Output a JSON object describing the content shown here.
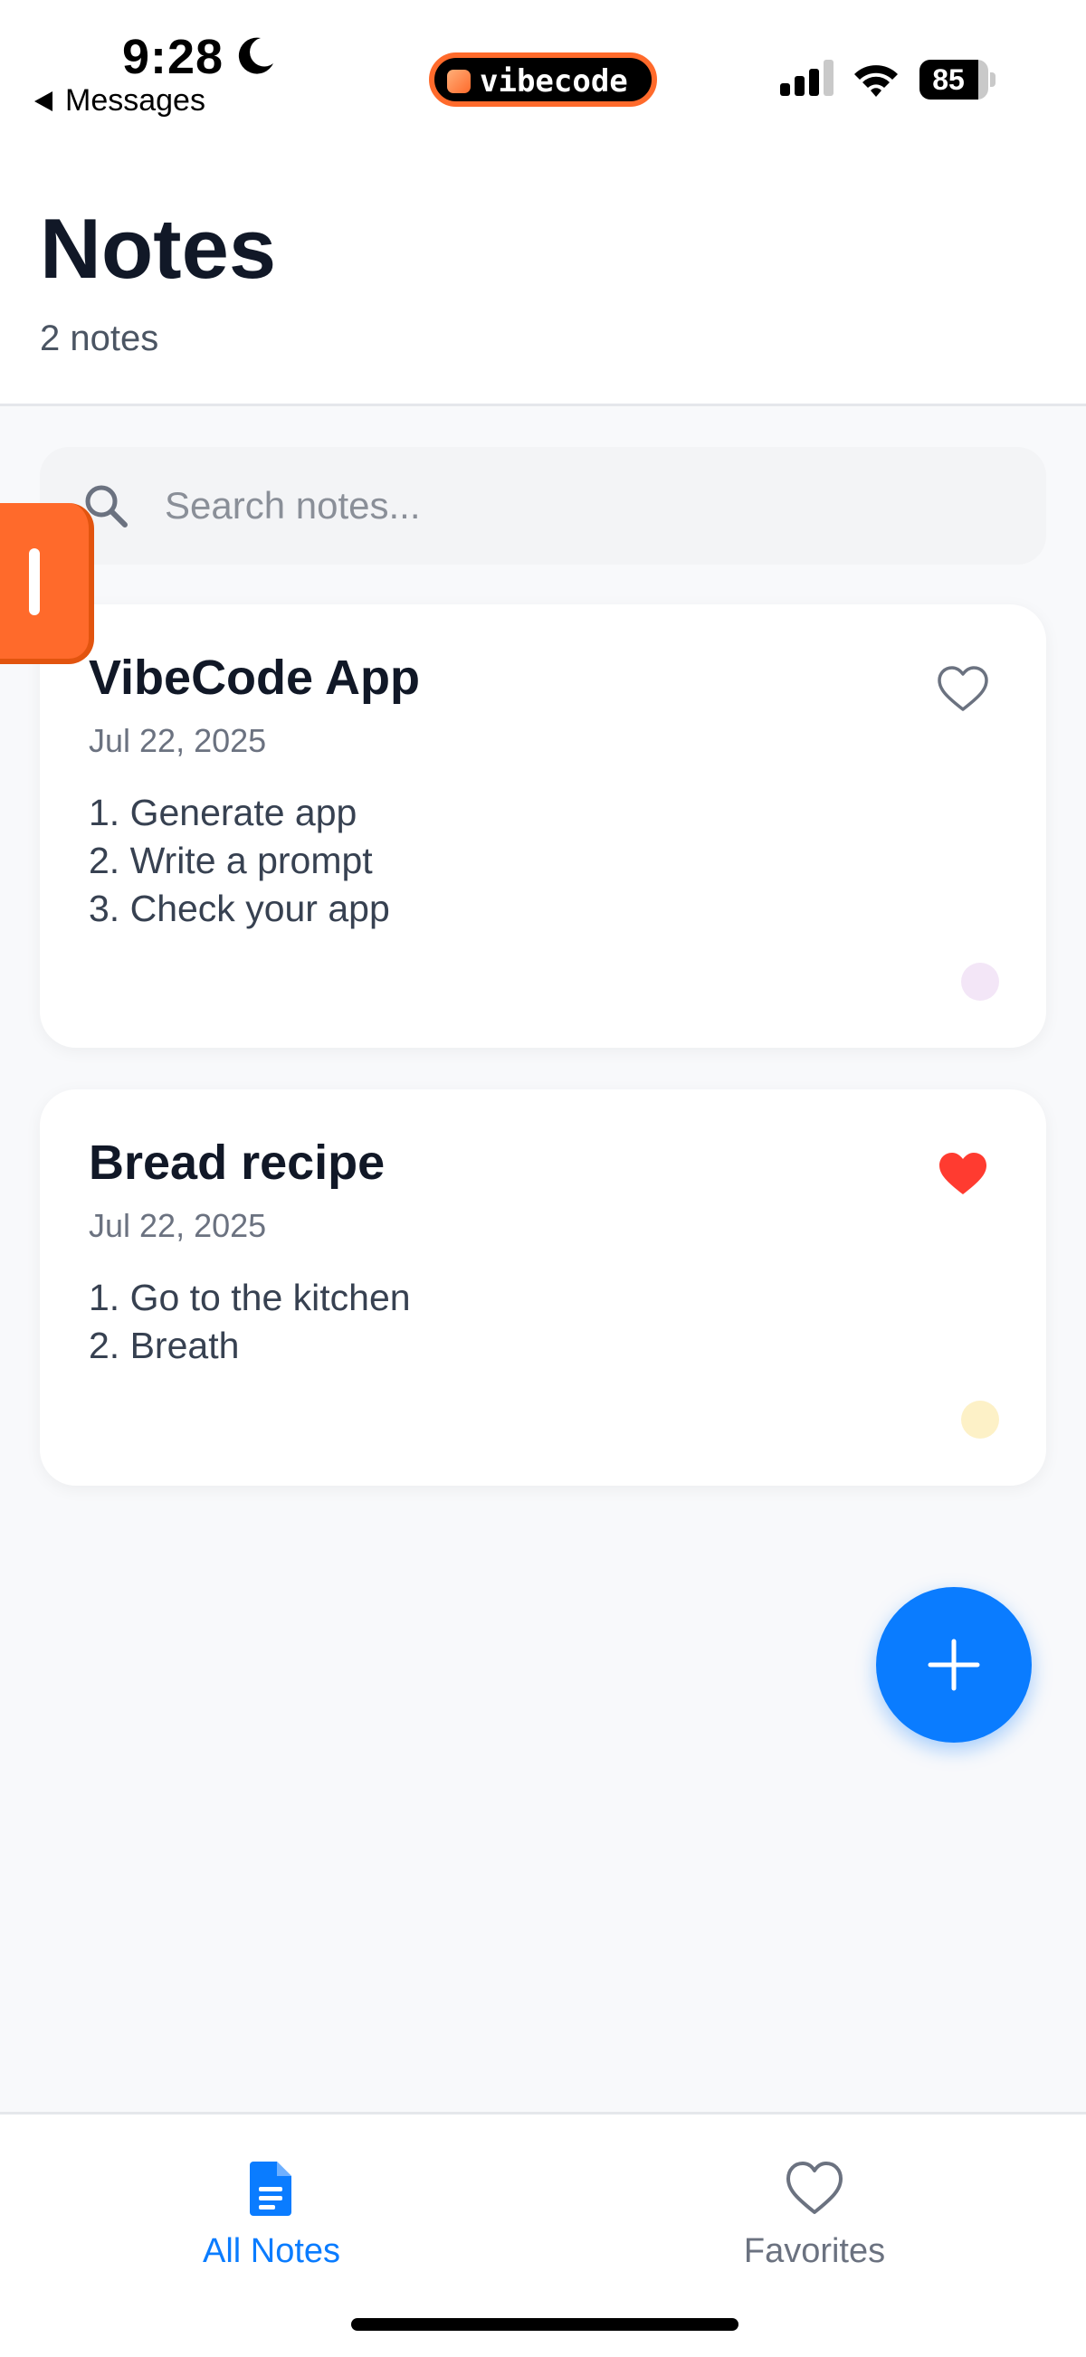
{
  "status_bar": {
    "time": "9:28",
    "back_label": "Messages",
    "pill_label": "vibecode",
    "battery_level": "85",
    "icons": [
      "moon-icon",
      "signal-icon",
      "wifi-icon",
      "battery-icon"
    ]
  },
  "header": {
    "title": "Notes",
    "subtitle": "2 notes"
  },
  "search": {
    "placeholder": "Search notes...",
    "value": ""
  },
  "notes": [
    {
      "title": "VibeCode App",
      "date": "Jul 22, 2025",
      "lines": [
        "1. Generate app",
        "2. Write a prompt",
        "3. Check your app"
      ],
      "favorite": false,
      "color": "#f3e6f7"
    },
    {
      "title": "Bread recipe",
      "date": "Jul 22, 2025",
      "lines": [
        "1. Go to the kitchen",
        "2. Breath"
      ],
      "favorite": true,
      "color": "#fdf1c7"
    }
  ],
  "tabbar": {
    "all_notes_label": "All Notes",
    "favorites_label": "Favorites",
    "active": "all_notes"
  },
  "colors": {
    "accent": "#0a7cff",
    "favorite": "#ff3b30",
    "brand_orange": "#ff6a2b"
  }
}
